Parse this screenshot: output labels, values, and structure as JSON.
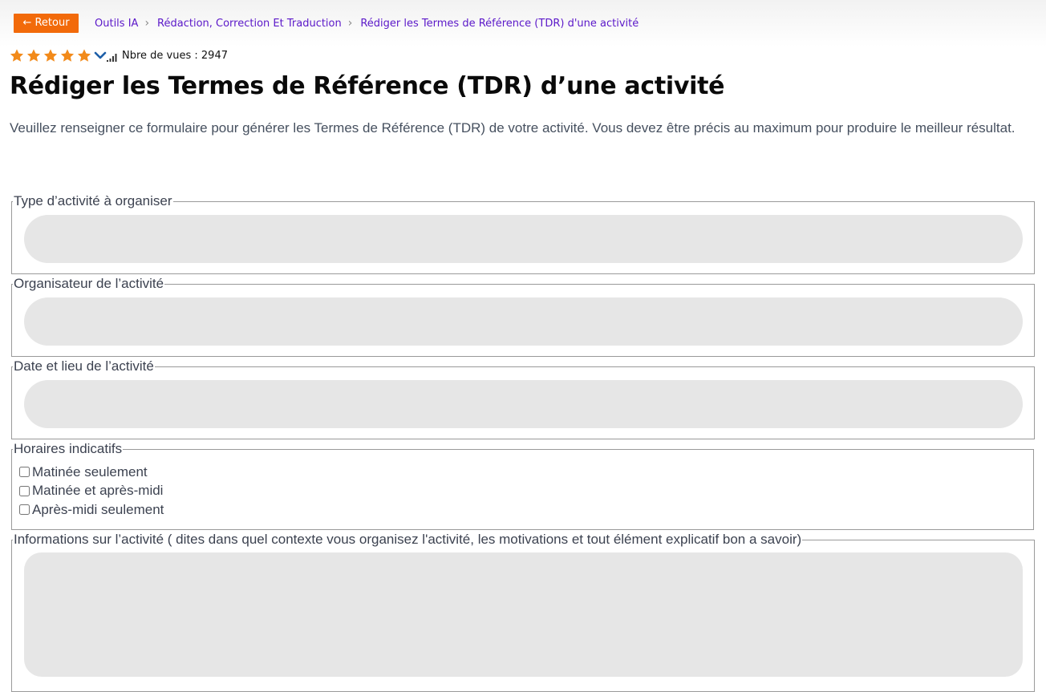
{
  "header": {
    "back_label": "← Retour",
    "breadcrumbs": [
      "Outils IA",
      "Rédaction, Correction Et Traduction",
      "Rédiger les Termes de Référence (TDR) d'une activité"
    ],
    "breadcrumb_separator": "›"
  },
  "meta": {
    "rating": 5,
    "rating_max": 5,
    "views_label": "Nbre de vues : 2947"
  },
  "page": {
    "title": "Rédiger les Termes de Référence (TDR) d’une activité",
    "intro": "Veuillez renseigner ce formulaire pour générer les Termes de Référence (TDR) de votre activité. Vous devez être précis au maximum pour produire le meilleur résultat."
  },
  "form": {
    "activity_type": {
      "legend": "Type d’activité à organiser",
      "value": "",
      "placeholder": ""
    },
    "organizer": {
      "legend": "Organisateur de l’activité",
      "value": "",
      "placeholder": ""
    },
    "date_place": {
      "legend": "Date et lieu de l’activité",
      "value": "",
      "placeholder": ""
    },
    "schedule": {
      "legend": "Horaires indicatifs",
      "options": [
        "Matinée seulement",
        "Matinée et après-midi",
        "Après-midi seulement"
      ]
    },
    "info": {
      "legend": "Informations sur l’activité ( dites dans quel contexte vous organisez l'activité, les motivations et tout élément explicatif bon a savoir)",
      "value": "",
      "placeholder": ""
    }
  },
  "colors": {
    "accent": "#f26a0a",
    "link": "#5b18c9",
    "star": "#f28a1a",
    "input_bg": "#e6e6e6"
  },
  "icons": [
    "star-icon",
    "chevron-down-icon",
    "signal-bars-icon"
  ]
}
